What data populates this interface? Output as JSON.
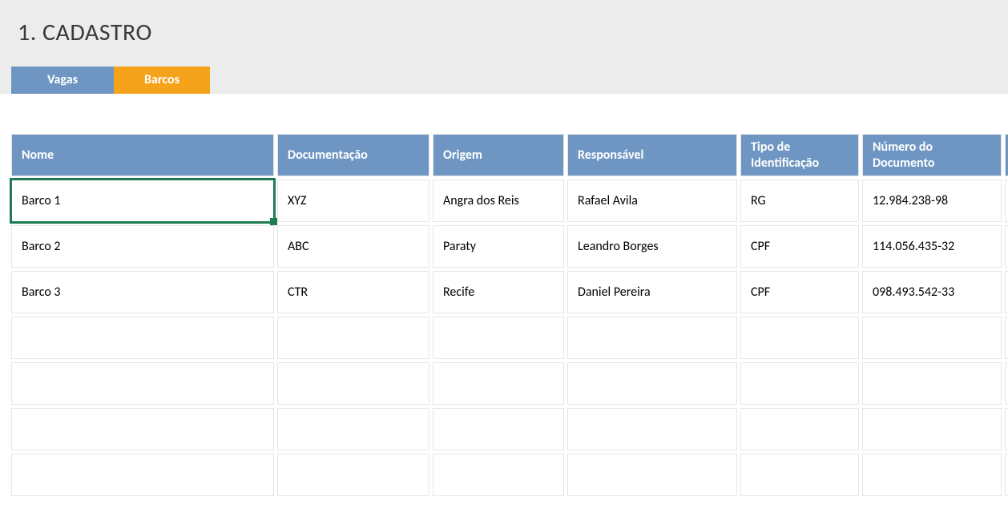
{
  "header": {
    "title": "1. CADASTRO"
  },
  "tabs": {
    "vagas": "Vagas",
    "barcos": "Barcos"
  },
  "table": {
    "columns": {
      "nome": "Nome",
      "documentacao": "Documentação",
      "origem": "Origem",
      "responsavel": "Responsável",
      "tipo_id": "Tipo de Identificação",
      "numero_doc": "Número do Documento"
    },
    "rows": [
      {
        "nome": "Barco 1",
        "documentacao": "XYZ",
        "origem": "Angra dos Reis",
        "responsavel": "Rafael Avila",
        "tipo_id": "RG",
        "numero_doc": "12.984.238-98"
      },
      {
        "nome": "Barco 2",
        "documentacao": "ABC",
        "origem": "Paraty",
        "responsavel": "Leandro Borges",
        "tipo_id": "CPF",
        "numero_doc": "114.056.435-32"
      },
      {
        "nome": "Barco 3",
        "documentacao": "CTR",
        "origem": "Recife",
        "responsavel": "Daniel Pereira",
        "tipo_id": "CPF",
        "numero_doc": "098.493.542-33"
      }
    ],
    "empty_row_count": 4
  },
  "colors": {
    "tab_inactive": "#6f96c3",
    "tab_active": "#f5a31a",
    "header_bg": "#6f96c3",
    "selection_border": "#1f7b53"
  }
}
